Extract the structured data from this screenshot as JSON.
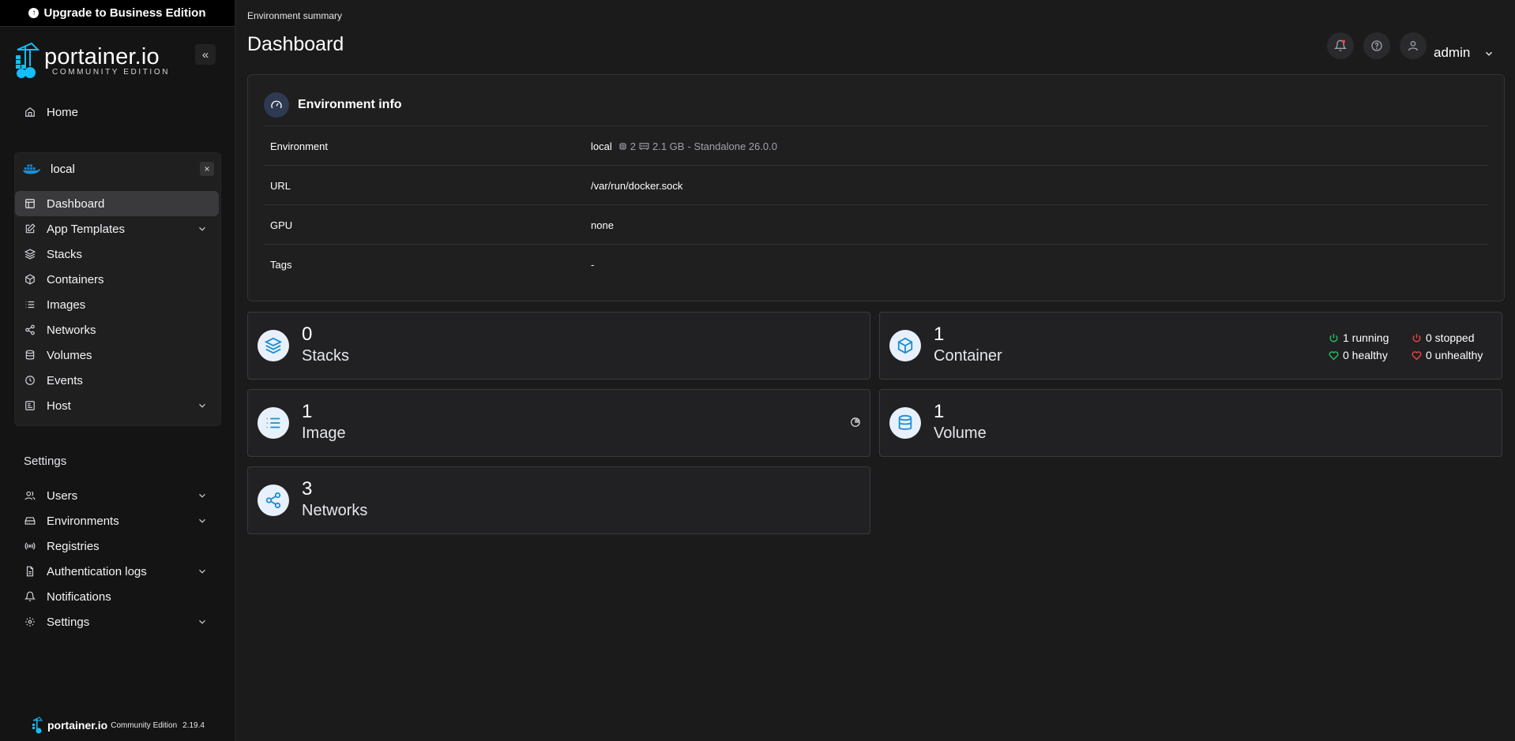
{
  "upgrade": {
    "label": "Upgrade to Business Edition"
  },
  "brand": {
    "name": "portainer.io",
    "edition": "COMMUNITY EDITION"
  },
  "sidebar": {
    "collapse_label": "«",
    "home": "Home",
    "environment": {
      "name": "local",
      "close": "×",
      "items": [
        {
          "label": "Dashboard",
          "icon": "dashboard-icon",
          "active": true
        },
        {
          "label": "App Templates",
          "icon": "edit-icon",
          "expandable": true
        },
        {
          "label": "Stacks",
          "icon": "layers-icon"
        },
        {
          "label": "Containers",
          "icon": "box-icon"
        },
        {
          "label": "Images",
          "icon": "list-icon"
        },
        {
          "label": "Networks",
          "icon": "share-icon"
        },
        {
          "label": "Volumes",
          "icon": "database-icon"
        },
        {
          "label": "Events",
          "icon": "clock-icon"
        },
        {
          "label": "Host",
          "icon": "host-icon",
          "expandable": true
        }
      ]
    },
    "settings_heading": "Settings",
    "settings_items": [
      {
        "label": "Users",
        "icon": "users-icon",
        "expandable": true
      },
      {
        "label": "Environments",
        "icon": "hdd-icon",
        "expandable": true
      },
      {
        "label": "Registries",
        "icon": "radio-icon"
      },
      {
        "label": "Authentication logs",
        "icon": "file-icon",
        "expandable": true
      },
      {
        "label": "Notifications",
        "icon": "bell-icon"
      },
      {
        "label": "Settings",
        "icon": "gear-icon",
        "expandable": true
      }
    ],
    "footer": {
      "brand": "portainer.io",
      "edition": "Community Edition",
      "version": "2.19.4"
    }
  },
  "header": {
    "breadcrumb": "Environment summary",
    "title": "Dashboard",
    "user": "admin"
  },
  "env_info": {
    "title": "Environment info",
    "rows": {
      "environment": {
        "key": "Environment",
        "name": "local",
        "cpu": "2",
        "memory": "2.1 GB",
        "type": "- Standalone 26.0.0"
      },
      "url": {
        "key": "URL",
        "value": "/var/run/docker.sock"
      },
      "gpu": {
        "key": "GPU",
        "value": "none"
      },
      "tags": {
        "key": "Tags",
        "value": "-"
      }
    }
  },
  "cards": {
    "stacks": {
      "count": "0",
      "label": "Stacks"
    },
    "containers": {
      "count": "1",
      "label": "Container",
      "running": "1 running",
      "stopped": "0 stopped",
      "healthy": "0 healthy",
      "unhealthy": "0 unhealthy"
    },
    "images": {
      "count": "1",
      "label": "Image"
    },
    "volumes": {
      "count": "1",
      "label": "Volume"
    },
    "networks": {
      "count": "3",
      "label": "Networks"
    }
  },
  "colors": {
    "accent": "#1d8ed1",
    "green": "#22c55e",
    "red": "#ef4444",
    "background": "#1b1b1c"
  }
}
